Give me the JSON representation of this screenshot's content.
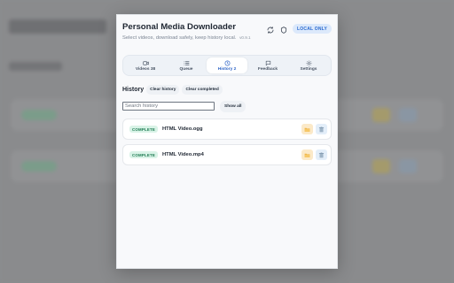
{
  "app": {
    "title": "Personal Media Downloader",
    "subtitle": "Select videos, download safely, keep history local.",
    "version": "v0.9.1",
    "badge": "LOCAL ONLY"
  },
  "tabs": [
    {
      "label": "Videos 38",
      "icon": "video-icon",
      "active": false
    },
    {
      "label": "Queue",
      "icon": "list-icon",
      "active": false
    },
    {
      "label": "History 2",
      "icon": "clock-icon",
      "active": true
    },
    {
      "label": "Feedback",
      "icon": "message-icon",
      "active": false
    },
    {
      "label": "Settings",
      "icon": "gear-icon",
      "active": false
    }
  ],
  "history": {
    "title": "History",
    "clear_history": "Clear history",
    "clear_completed": "Clear completed",
    "search_placeholder": "Search history",
    "show_all": "Show all",
    "items": [
      {
        "status": "COMPLETE",
        "name": "HTML Video.ogg"
      },
      {
        "status": "COMPLETE",
        "name": "HTML Video.mp4"
      }
    ]
  },
  "colors": {
    "accent": "#2b62c6",
    "status_complete": "#1d7a51",
    "status_complete_bg": "#d9f3e7",
    "open_button_bg": "#fbe9c8",
    "delete_button_bg": "#e3eef9"
  }
}
